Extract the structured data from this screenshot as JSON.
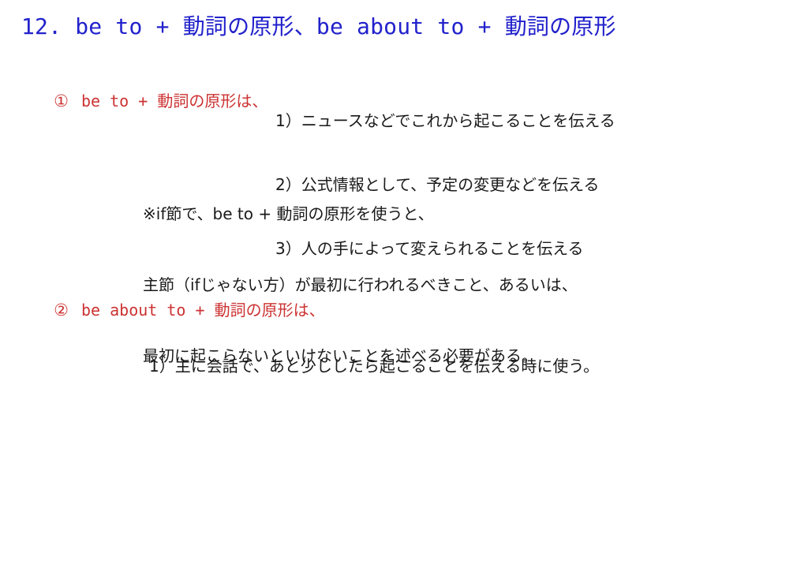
{
  "slide": {
    "title": "12. be to + 動詞の原形、be about to + 動詞の原形",
    "background_color": "#ffffff",
    "title_color": "#2222cc",
    "accent_color": "#cc3333",
    "body_color": "#1a1a1a",
    "sections": [
      {
        "marker": "①",
        "heading": "be to + 動詞の原形は、",
        "items": [
          "1）ニュースなどでこれから起こることを伝える",
          "2）公式情報として、予定の変更などを伝える",
          "3）人の手によって変えられることを伝える"
        ]
      },
      {
        "marker": "②",
        "heading": "be about to + 動詞の原形は、",
        "items": [
          "1）主に会話で、あと少ししたら起こることを伝える時に使う。"
        ]
      }
    ],
    "note": {
      "lines": [
        "※if節で、be to + 動詞の原形を使うと、",
        "主節（ifじゃない方）が最初に行われるべきこと、あるいは、",
        "最初に起こらないといけないことを述べる必要がある。"
      ]
    }
  }
}
